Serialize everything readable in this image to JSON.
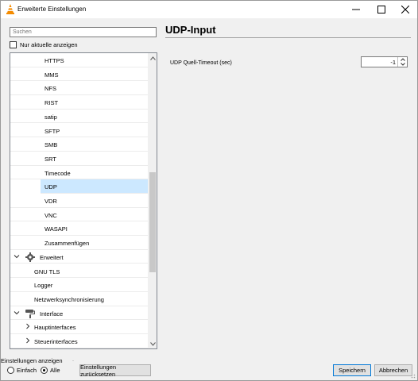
{
  "window": {
    "title": "Erweiterte Einstellungen",
    "icon": "vlc-cone-icon",
    "controls": [
      "minimize-icon",
      "maximize-icon",
      "close-icon"
    ]
  },
  "left": {
    "search_placeholder": "Suchen",
    "only_current_label": "Nur aktuelle anzeigen",
    "only_current_checked": false,
    "tree": [
      {
        "label": "HTTPS",
        "level": 2
      },
      {
        "label": "MMS",
        "level": 2
      },
      {
        "label": "NFS",
        "level": 2
      },
      {
        "label": "RIST",
        "level": 2
      },
      {
        "label": "satip",
        "level": 2
      },
      {
        "label": "SFTP",
        "level": 2
      },
      {
        "label": "SMB",
        "level": 2
      },
      {
        "label": "SRT",
        "level": 2
      },
      {
        "label": "Timecode",
        "level": 2
      },
      {
        "label": "UDP",
        "level": 2,
        "selected": true
      },
      {
        "label": "VDR",
        "level": 2
      },
      {
        "label": "VNC",
        "level": 2
      },
      {
        "label": "WASAPI",
        "level": 2
      },
      {
        "label": "Zusammenfügen",
        "level": 2
      },
      {
        "label": "Erweitert",
        "level": 0,
        "expanded": true,
        "icon": "gear-icon"
      },
      {
        "label": "GNU TLS",
        "level": 1
      },
      {
        "label": "Logger",
        "level": 1
      },
      {
        "label": "Netzwerksynchronisierung",
        "level": 1
      },
      {
        "label": "Interface",
        "level": 0,
        "expanded": true,
        "icon": "paint-roller-icon"
      },
      {
        "label": "Hauptinterfaces",
        "level": 1,
        "expandable": true
      },
      {
        "label": "Steuerinterfaces",
        "level": 1,
        "expandable": true
      }
    ]
  },
  "right": {
    "title": "UDP-Input",
    "option_label": "UDP Quell-Timeout (sec)",
    "option_value": "-1"
  },
  "footer": {
    "group_label": "Einstellungen anzeigen",
    "radio_simple": "Einfach",
    "radio_all": "Alle",
    "selected_mode": "Alle",
    "reset_button": "Einstellungen zurücksetzen",
    "save_button": "Speichern",
    "cancel_button": "Abbrechen"
  },
  "colors": {
    "selection": "#cce8ff",
    "accent_border": "#0078d7",
    "vlc_orange": "#f48b00"
  }
}
